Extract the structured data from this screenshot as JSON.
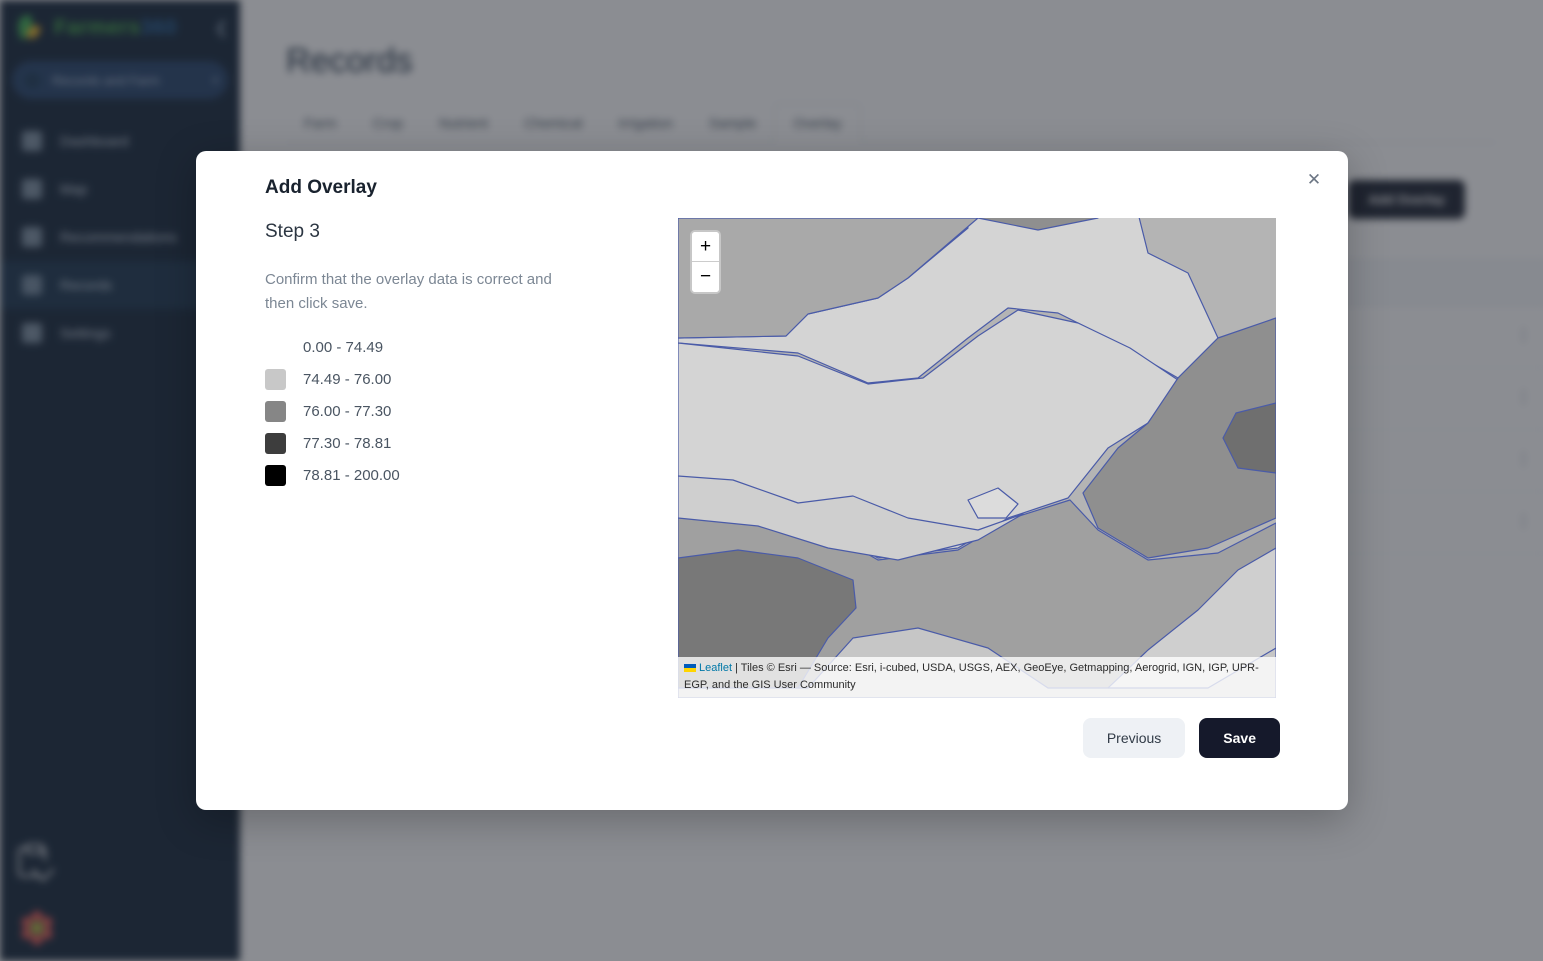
{
  "app": {
    "brand_name_part1": "Farmers",
    "brand_name_part2": "360",
    "collapse_icon": "chevron-left-icon",
    "search_placeholder": "Records and Farm",
    "nav_items": [
      {
        "label": "Dashboard",
        "icon": "dashboard-icon",
        "active": false
      },
      {
        "label": "Map",
        "icon": "map-icon",
        "active": false
      },
      {
        "label": "Recommendations",
        "icon": "recommendations-icon",
        "active": false
      },
      {
        "label": "Records",
        "icon": "records-icon",
        "active": true
      },
      {
        "label": "Settings",
        "icon": "settings-icon",
        "active": false
      }
    ],
    "bottom_icons": [
      {
        "name": "clipboard-export-icon"
      },
      {
        "name": "flower-logo"
      }
    ]
  },
  "page": {
    "title": "Records",
    "tabs": [
      {
        "label": "Farm",
        "active": false
      },
      {
        "label": "Crop",
        "active": false
      },
      {
        "label": "Nutrient",
        "active": false
      },
      {
        "label": "Chemical",
        "active": false
      },
      {
        "label": "Irrigation",
        "active": false
      },
      {
        "label": "Sample",
        "active": false
      },
      {
        "label": "Overlay",
        "active": true
      }
    ],
    "add_button_label": "Add Overlay",
    "row_menu_glyph": "⋮",
    "row_count": 4
  },
  "modal": {
    "title": "Add Overlay",
    "step_title": "Step 3",
    "description": "Confirm that the overlay data is correct and then click save.",
    "close_icon": "close-icon",
    "legend": [
      {
        "range": "0.00 - 74.49",
        "color": "",
        "has_swatch": false
      },
      {
        "range": "74.49 - 76.00",
        "color": "#c8c8c8",
        "has_swatch": true
      },
      {
        "range": "76.00 - 77.30",
        "color": "#868686",
        "has_swatch": true
      },
      {
        "range": "77.30 - 78.81",
        "color": "#3d3d3d",
        "has_swatch": true
      },
      {
        "range": "78.81 - 200.00",
        "color": "#000000",
        "has_swatch": true
      }
    ],
    "buttons": {
      "previous_label": "Previous",
      "save_label": "Save"
    }
  },
  "map": {
    "zoom_in_label": "+",
    "zoom_out_label": "−",
    "attribution_leaflet": "Leaflet",
    "attribution_text": " | Tiles © Esri — Source: Esri, i-cubed, USDA, USGS, AEX, GeoEye, Getmapping, Aerogrid, IGN, IGP, UPR-EGP, and the GIS User Community",
    "polygon_stroke": "#4a5ba8",
    "fill_light": "#d4d4d4",
    "fill_mid": "#b4b4b4",
    "fill_dark": "#8f8f8f",
    "fill_darker": "#7a7a7a",
    "fill_lightest": "#e2e2e2"
  },
  "colors": {
    "sidebar_bg": "#0a1c30",
    "accent_primary": "#15192b",
    "scrim": "rgba(44,48,56,0.55)"
  }
}
